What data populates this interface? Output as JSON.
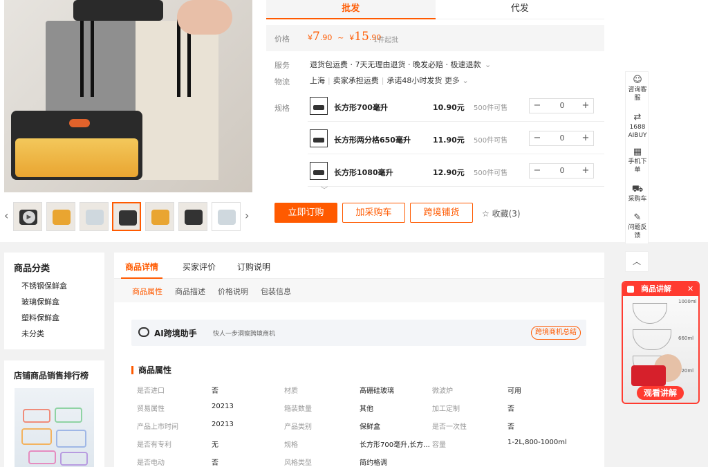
{
  "tabs": {
    "wholesale": "批发",
    "dropship": "代发"
  },
  "price": {
    "label": "价格",
    "currency": "¥",
    "low_int": "7",
    "low_dec": ".90",
    "tilde": "~",
    "high_int": "15",
    "high_dec": ".90",
    "moq": "1件起批"
  },
  "service": {
    "label": "服务",
    "text": "退货包运费 · 7天无理由退货 · 晚发必赔 · 极速退款",
    "chevron": "⌄"
  },
  "logistics": {
    "label": "物流",
    "from": "上海",
    "shipping": "卖家承担运费",
    "promise": "承诺48小时发货",
    "more": "更多"
  },
  "spec": {
    "label": "规格",
    "items": [
      {
        "name": "长方形700毫升",
        "price": "10.90元",
        "stock": "500件可售",
        "qty": "0"
      },
      {
        "name": "长方形两分格650毫升",
        "price": "11.90元",
        "stock": "500件可售",
        "qty": "0"
      },
      {
        "name": "长方形1080毫升",
        "price": "12.90元",
        "stock": "500件可售",
        "qty": "0"
      }
    ],
    "minus": "−",
    "plus": "+"
  },
  "actions": {
    "order": "立即订购",
    "cart": "加采购车",
    "crossborder": "跨境铺货",
    "fav": "收藏(3)"
  },
  "side_toolbar": {
    "consult": "咨询客服",
    "aibuy": "1688 AIBUY",
    "mobile": "手机下单",
    "cart": "采购车",
    "feedback": "问题反馈",
    "top": "︿"
  },
  "category": {
    "title": "商品分类",
    "items": [
      "不锈钢保鲜盒",
      "玻璃保鲜盒",
      "塑料保鲜盒",
      "未分类"
    ]
  },
  "ranking": {
    "title": "店铺商品销售排行榜"
  },
  "detail_tabs": {
    "items": [
      "商品详情",
      "买家评价",
      "订购说明"
    ]
  },
  "sub_tabs": {
    "items": [
      "商品属性",
      "商品描述",
      "价格说明",
      "包装信息"
    ]
  },
  "ai_assistant": {
    "title": "AI跨境助手",
    "subtitle": "快人一步洞察跨境商机",
    "cta": "跨境商机总结"
  },
  "attributes": {
    "title": "商品属性",
    "rows": [
      [
        [
          "是否进口",
          "否"
        ],
        [
          "材质",
          "高硼硅玻璃"
        ],
        [
          "微波炉",
          "可用"
        ]
      ],
      [
        [
          "贸易属性",
          "20213"
        ],
        [
          "箱装数量",
          "其他"
        ],
        [
          "加工定制",
          "否"
        ]
      ],
      [
        [
          "产品上市时间",
          "20213"
        ],
        [
          "产品类别",
          "保鲜盒"
        ],
        [
          "是否一次性",
          "否"
        ]
      ],
      [
        [
          "是否有专利",
          "无"
        ],
        [
          "规格",
          "长方形700毫升,长方..."
        ],
        [
          "容量",
          "1-2L,800-1000ml"
        ]
      ],
      [
        [
          "是否电动",
          "否"
        ],
        [
          "风格类型",
          "简约格调"
        ],
        [
          "",
          ""
        ]
      ]
    ]
  },
  "video": {
    "title": "商品讲解",
    "close": "✕",
    "watch": "观看讲解",
    "labels": [
      "1000ml",
      "660ml",
      "420ml"
    ]
  },
  "colors": {
    "accent": "#ff5a00",
    "video_red": "#ff3b30"
  }
}
